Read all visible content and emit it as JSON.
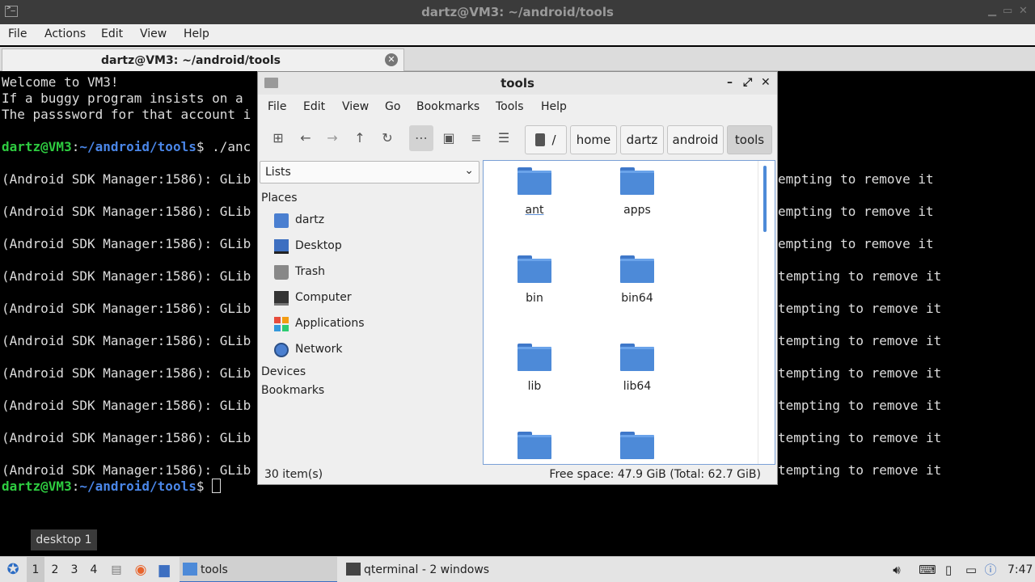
{
  "terminal": {
    "window_title": "dartz@VM3: ~/android/tools",
    "menu": [
      "File",
      "Actions",
      "Edit",
      "View",
      "Help"
    ],
    "tab_title": "dartz@VM3: ~/android/tools",
    "lines": {
      "l0": "Welcome to VM3!",
      "l1": "If a buggy program insists on a",
      "l2": "The passsword for that account i",
      "p3_user": "dartz@VM3",
      "p3_sep": ":",
      "p3_path": "~/android/tools",
      "p3_cmd": "$ ./anc",
      "sdk_prefix": "(Android SDK Manager:1586): GLib",
      "right_a": "empting to remove it",
      "right_b": "tempting to remove it",
      "p_last_user": "dartz@VM3",
      "p_last_path": "~/android/tools",
      "p_last_cmd": "$ "
    }
  },
  "file_manager": {
    "title": "tools",
    "menu": [
      "File",
      "Edit",
      "View",
      "Go",
      "Bookmarks",
      "Tools",
      "Help"
    ],
    "breadcrumbs": [
      "/",
      "home",
      "dartz",
      "android",
      "tools"
    ],
    "sidebar_mode": "Lists",
    "sections": {
      "places": "Places",
      "devices": "Devices",
      "bookmarks": "Bookmarks"
    },
    "places": [
      "dartz",
      "Desktop",
      "Trash",
      "Computer",
      "Applications",
      "Network"
    ],
    "files": [
      "ant",
      "apps",
      "bin",
      "bin64",
      "lib",
      "lib64",
      "",
      ""
    ],
    "status_items": "30 item(s)",
    "status_space": "Free space: 47.9 GiB (Total: 62.7 GiB)"
  },
  "desktop_label": "desktop 1",
  "taskbar": {
    "workspaces": [
      "1",
      "2",
      "3",
      "4"
    ],
    "tasks": [
      "tools",
      "qterminal - 2 windows"
    ],
    "clock": "7:47"
  }
}
